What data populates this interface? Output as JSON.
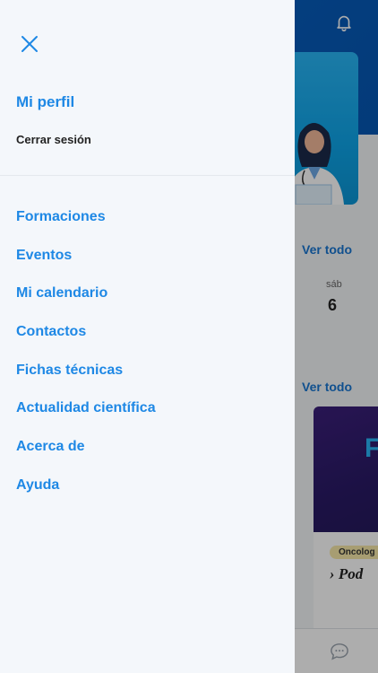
{
  "drawer": {
    "profile_label": "Mi perfil",
    "logout_label": "Cerrar sesión",
    "menu": [
      {
        "label": "Formaciones"
      },
      {
        "label": "Eventos"
      },
      {
        "label": "Mi calendario"
      },
      {
        "label": "Contactos"
      },
      {
        "label": "Fichas técnicas"
      },
      {
        "label": "Actualidad científica"
      },
      {
        "label": "Acerca de"
      },
      {
        "label": "Ayuda"
      }
    ]
  },
  "background": {
    "see_all_1": "Ver todo",
    "see_all_2": "Ver todo",
    "calendar": {
      "weekday": "sáb",
      "day": "6"
    },
    "promo_letter": "F",
    "article_tag": "Oncolog",
    "article_title": "Pod"
  },
  "colors": {
    "accent": "#1e88e5",
    "header_blue": "#0a63c6",
    "drawer_bg": "#f4f7fb"
  },
  "icons": [
    "close-icon",
    "bell-icon",
    "chevron-right-icon",
    "chat-icon"
  ]
}
